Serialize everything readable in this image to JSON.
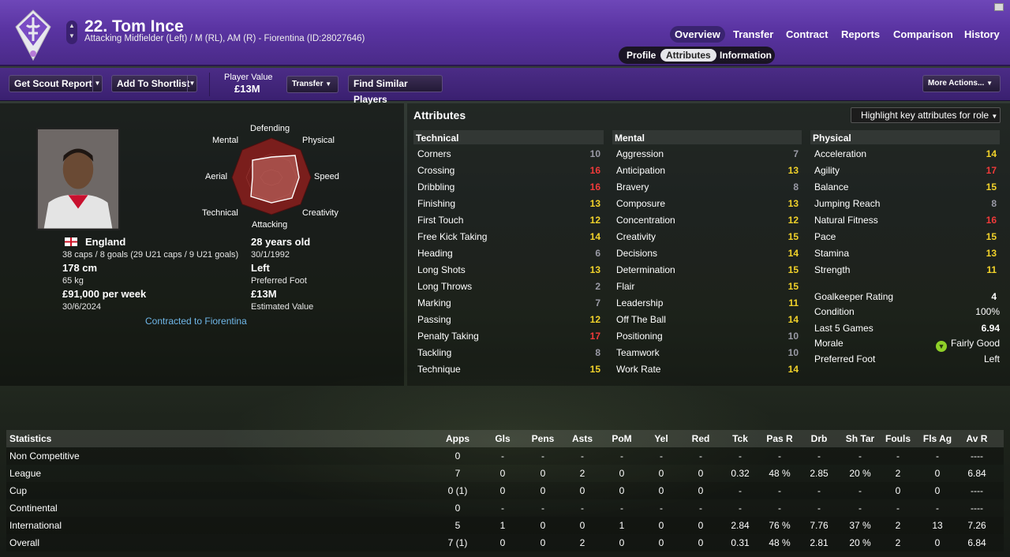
{
  "header": {
    "player_name": "22. Tom Ince",
    "player_sub": "Attacking Midfielder (Left) / M (RL), AM (R) - Fiorentina (ID:28027646)",
    "tabs": [
      "Overview",
      "Transfer",
      "Contract",
      "Reports",
      "Comparison",
      "History"
    ],
    "active_tab": "Overview",
    "subtabs": [
      "Profile",
      "Attributes",
      "Information"
    ],
    "active_subtab": "Attributes"
  },
  "toolbar": {
    "scout": "Get Scout Report",
    "shortlist": "Add To Shortlist",
    "player_value_label": "Player Value",
    "player_value": "£13M",
    "transfer": "Transfer",
    "similar": "Find Similar Players",
    "more": "More Actions..."
  },
  "profile": {
    "polygon_labels": {
      "top": "Defending",
      "tl": "Mental",
      "tr": "Physical",
      "l": "Aerial",
      "r": "Speed",
      "bl": "Technical",
      "br": "Creativity",
      "bottom": "Attacking"
    },
    "nation": "England",
    "caps": "38 caps / 8 goals (29 U21 caps / 9 U21 goals)",
    "age": "28 years old",
    "dob": "30/1/1992",
    "height": "178 cm",
    "weight": "65 kg",
    "foot": "Left",
    "foot_label": "Preferred Foot",
    "wage": "£91,000 per week",
    "contract_end": "30/6/2024",
    "value": "£13M",
    "value_label": "Estimated Value",
    "contracted": "Contracted to Fiorentina"
  },
  "attributes": {
    "title": "Attributes",
    "highlight": "Highlight key attributes for role",
    "technical": {
      "title": "Technical",
      "items": [
        [
          "Corners",
          10
        ],
        [
          "Crossing",
          16
        ],
        [
          "Dribbling",
          16
        ],
        [
          "Finishing",
          13
        ],
        [
          "First Touch",
          12
        ],
        [
          "Free Kick Taking",
          14
        ],
        [
          "Heading",
          6
        ],
        [
          "Long Shots",
          13
        ],
        [
          "Long Throws",
          2
        ],
        [
          "Marking",
          7
        ],
        [
          "Passing",
          12
        ],
        [
          "Penalty Taking",
          17
        ],
        [
          "Tackling",
          8
        ],
        [
          "Technique",
          15
        ]
      ]
    },
    "mental": {
      "title": "Mental",
      "items": [
        [
          "Aggression",
          7
        ],
        [
          "Anticipation",
          13
        ],
        [
          "Bravery",
          8
        ],
        [
          "Composure",
          13
        ],
        [
          "Concentration",
          12
        ],
        [
          "Creativity",
          15
        ],
        [
          "Decisions",
          14
        ],
        [
          "Determination",
          15
        ],
        [
          "Flair",
          15
        ],
        [
          "Leadership",
          11
        ],
        [
          "Off The Ball",
          14
        ],
        [
          "Positioning",
          10
        ],
        [
          "Teamwork",
          10
        ],
        [
          "Work Rate",
          14
        ]
      ]
    },
    "physical": {
      "title": "Physical",
      "items": [
        [
          "Acceleration",
          14
        ],
        [
          "Agility",
          17
        ],
        [
          "Balance",
          15
        ],
        [
          "Jumping Reach",
          8
        ],
        [
          "Natural Fitness",
          16
        ],
        [
          "Pace",
          15
        ],
        [
          "Stamina",
          13
        ],
        [
          "Strength",
          11
        ]
      ]
    },
    "misc": [
      [
        "Goalkeeper Rating",
        "4"
      ],
      [
        "Condition",
        "100%"
      ],
      [
        "Last 5 Games",
        "6.94"
      ],
      [
        "Morale",
        "Fairly Good"
      ],
      [
        "Preferred Foot",
        "Left"
      ]
    ]
  },
  "stats": {
    "headers": [
      "Statistics",
      "Apps",
      "Gls",
      "Pens",
      "Asts",
      "PoM",
      "Yel",
      "Red",
      "Tck",
      "Pas R",
      "Drb",
      "Sh Tar",
      "Fouls",
      "Fls Ag",
      "Av R"
    ],
    "rows": [
      [
        "Non Competitive",
        "0",
        "-",
        "-",
        "-",
        "-",
        "-",
        "-",
        "-",
        "-",
        "-",
        "-",
        "-",
        "-",
        "----"
      ],
      [
        "League",
        "7",
        "0",
        "0",
        "2",
        "0",
        "0",
        "0",
        "0.32",
        "48 %",
        "2.85",
        "20 %",
        "2",
        "0",
        "6.84"
      ],
      [
        "Cup",
        "0 (1)",
        "0",
        "0",
        "0",
        "0",
        "0",
        "0",
        "-",
        "-",
        "-",
        "-",
        "0",
        "0",
        "----"
      ],
      [
        "Continental",
        "0",
        "-",
        "-",
        "-",
        "-",
        "-",
        "-",
        "-",
        "-",
        "-",
        "-",
        "-",
        "-",
        "----"
      ],
      [
        "International",
        "5",
        "1",
        "0",
        "0",
        "1",
        "0",
        "0",
        "2.84",
        "76 %",
        "7.76",
        "37 %",
        "2",
        "13",
        "7.26"
      ],
      [
        "Overall",
        "7 (1)",
        "0",
        "0",
        "2",
        "0",
        "0",
        "0",
        "0.31",
        "48 %",
        "2.81",
        "20 %",
        "2",
        "0",
        "6.84"
      ]
    ]
  },
  "colors": {
    "header": "#5a34a2",
    "grey": "#9a9aa6",
    "yellow": "#f2d22a",
    "red": "#f03a3a",
    "link": "#6fb7e8",
    "morale": "#8fd028"
  }
}
